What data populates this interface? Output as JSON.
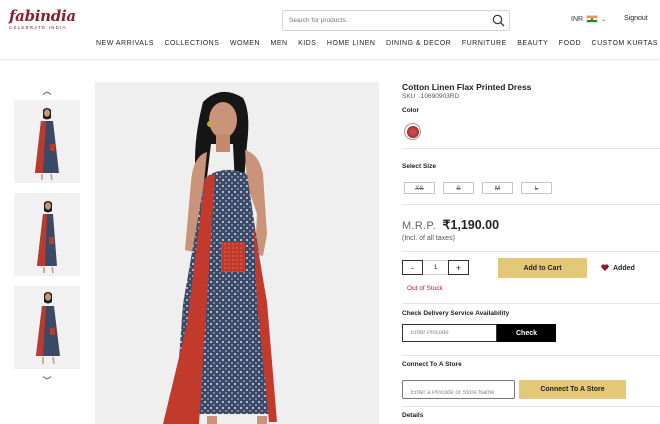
{
  "header": {
    "logo_text": "fabindia",
    "logo_tagline": "CELEBRATE INDIA",
    "search_placeholder": "Search for products.",
    "currency": "INR",
    "signout": "Signout"
  },
  "nav": {
    "items": [
      {
        "label": "NEW ARRIVALS"
      },
      {
        "label": "COLLECTIONS"
      },
      {
        "label": "WOMEN"
      },
      {
        "label": "MEN"
      },
      {
        "label": "KIDS"
      },
      {
        "label": "HOME LINEN"
      },
      {
        "label": "DINING & DECOR"
      },
      {
        "label": "FURNITURE"
      },
      {
        "label": "BEAUTY"
      },
      {
        "label": "FOOD"
      },
      {
        "label": "CUSTOM KURTAS"
      }
    ]
  },
  "product": {
    "title": "Cotton Linen Flax Printed Dress",
    "sku": "SKU : 10690903RD",
    "color_label": "Color",
    "size_label": "Select Size",
    "sizes": [
      "XS",
      "S",
      "M",
      "L"
    ],
    "mrp_label": "M.R.P.",
    "price": "₹1,190.00",
    "taxes_note": "(Incl. of all taxes)",
    "quantity": "1",
    "qty_minus": "-",
    "qty_plus": "+",
    "add_to_cart": "Add to Cart",
    "wishlist_label": "Added",
    "stock_status": "Out of Stock"
  },
  "delivery": {
    "heading": "Check Delivery Service Availability",
    "pincode_placeholder": "Enter Pincode",
    "check_label": "Check"
  },
  "store": {
    "heading": "Connect To A Store",
    "placeholder": "Enter a Pincode or Store Name",
    "button_label": "Connect To A Store"
  },
  "details": {
    "heading": "Details"
  },
  "colors": {
    "brand": "#8b1e2d",
    "accent_button": "#e4c777",
    "stock_red": "#c12020"
  }
}
